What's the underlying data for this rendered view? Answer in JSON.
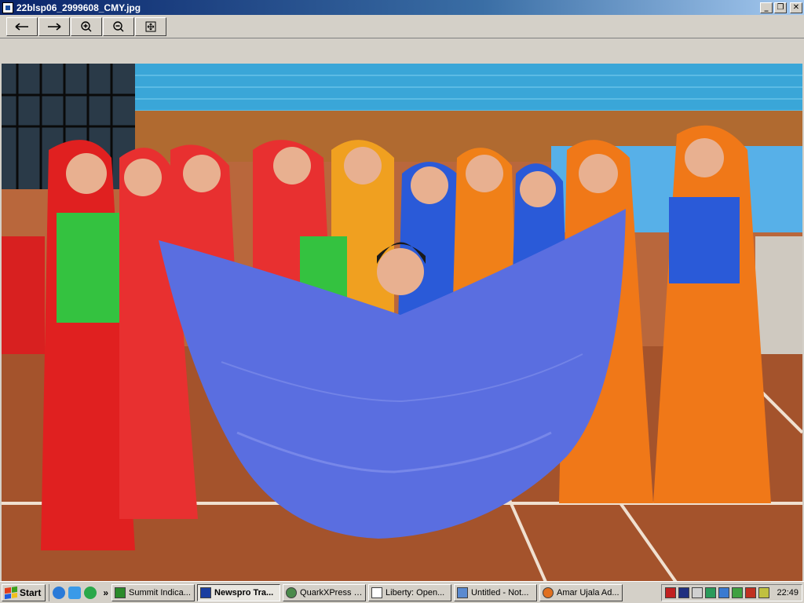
{
  "window": {
    "title": "22blsp06_2999608_CMY.jpg",
    "minimize_icon": "minimize-icon",
    "maximize_icon": "restore-icon",
    "close_icon": "close-icon"
  },
  "toolbar": {
    "buttons": [
      {
        "icon": "previous-arrow-icon"
      },
      {
        "icon": "next-arrow-icon"
      },
      {
        "icon": "zoom-in-icon"
      },
      {
        "icon": "zoom-out-icon"
      },
      {
        "icon": "fit-to-window-icon"
      }
    ]
  },
  "photo": {
    "subject": "photograph"
  },
  "taskbar": {
    "start_label": "Start",
    "chevron": "»",
    "tasks": [
      {
        "label": "Summit Indica...",
        "color": "#2a8a2a"
      },
      {
        "label": "Newspro Tra...",
        "color": "#1a3ea0",
        "active": true
      },
      {
        "label": "QuarkXPress (...",
        "color": "#4a8a4a"
      },
      {
        "label": "Liberty: Open...",
        "color": "#ffffff"
      },
      {
        "label": "Untitled - Not...",
        "color": "#5a8ad0"
      },
      {
        "label": "Amar Ujala Ad...",
        "color": "#e07020"
      }
    ],
    "clock": "22:49"
  }
}
